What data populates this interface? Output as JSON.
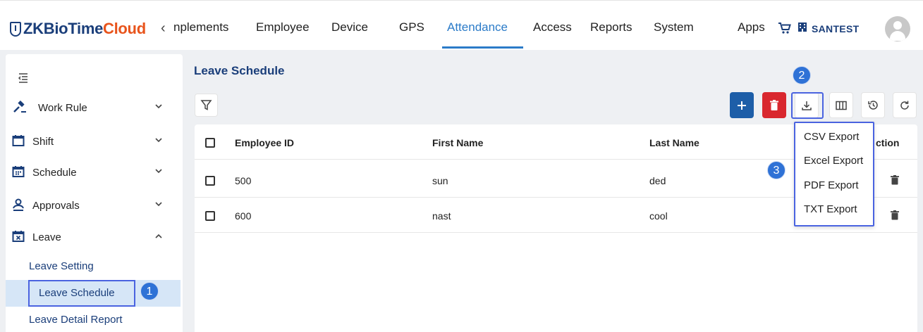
{
  "header": {
    "logo_part1": "ZKBioTime",
    "logo_part2": "Cloud",
    "nav_prev": "‹",
    "nav": [
      "nplements",
      "Employee",
      "Device",
      "GPS",
      "Attendance",
      "Access",
      "Reports",
      "System",
      "Apps"
    ],
    "active_nav": "Attendance",
    "company": "SANTEST",
    "accent_color": "#2b7bc8"
  },
  "sidebar": {
    "items": [
      {
        "label": "Work Rule",
        "icon": "gavel-icon",
        "expanded": false
      },
      {
        "label": "Shift",
        "icon": "calendar-blank-icon",
        "expanded": false
      },
      {
        "label": "Schedule",
        "icon": "calendar-grid-icon",
        "expanded": false
      },
      {
        "label": "Approvals",
        "icon": "person-approve-icon",
        "expanded": false
      },
      {
        "label": "Leave",
        "icon": "calendar-x-icon",
        "expanded": true
      }
    ],
    "sub_items": [
      "Leave Setting",
      "Leave Schedule",
      "Leave Detail Report"
    ],
    "active_sub": "Leave Schedule"
  },
  "main": {
    "title": "Leave Schedule",
    "columns": [
      "Employee ID",
      "First Name",
      "Last Name",
      "ction"
    ],
    "rows": [
      {
        "employee_id": "500",
        "first_name": "sun",
        "last_name": "ded"
      },
      {
        "employee_id": "600",
        "first_name": "nast",
        "last_name": "cool"
      }
    ],
    "export_menu": [
      "CSV Export",
      "Excel Export",
      "PDF Export",
      "TXT Export"
    ]
  },
  "badges": [
    "1",
    "2",
    "3"
  ],
  "colors": {
    "primary": "#1d5ea8",
    "danger": "#d9272e",
    "highlight": "#4a63e0",
    "brand_dark": "#1a3e7a",
    "brand_orange": "#e8541c"
  }
}
